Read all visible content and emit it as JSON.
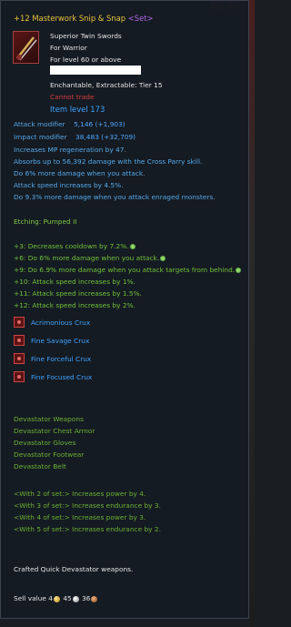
{
  "header": {
    "title": "+12 Masterwork Snip & Snap",
    "set_tag": "<Set>"
  },
  "item": {
    "type": "Superior Twin Swords",
    "class": "For Warrior",
    "level_req": "For level 60 or above",
    "enchant": "Enchantable, Extractable: Tier 15",
    "trade": "Cannot trade",
    "item_level": "Item level 173"
  },
  "stats": {
    "attack_label": "Attack modifier",
    "attack_value": "5,146 (+1,903)",
    "impact_label": "Impact modifier",
    "impact_value": "38,483 (+32,709)"
  },
  "bonuses": [
    "Increases MP regeneration by 47.",
    "Absorbs up to 56,392 damage with the Cross Parry skill.",
    "Do 6% more damage when you attack.",
    "Attack speed increases by 4.5%.",
    "Do 9.3% more damage when you attack enraged monsters."
  ],
  "etching": "Etching: Pumped II",
  "enchant_bonuses": [
    "+3: Decreases cooldown by 7.2%.",
    "+6: Do 6% more damage when you attack.",
    "+9: Do 6.9% more damage when you attack targets from behind.",
    "+10: Attack speed increases by 1%.",
    "+11: Attack speed increases by 1.5%.",
    "+12: Attack speed increases by 2%."
  ],
  "crux": [
    "Acrimonious Crux",
    "Fine Savage Crux",
    "Fine Forceful Crux",
    "Fine Focused Crux"
  ],
  "set_items": [
    "Devastator Weapons",
    "Devastator Chest Armor",
    "Devastator Gloves",
    "Devastator Footwear",
    "Devastator Belt"
  ],
  "set_bonuses": [
    "<With 2 of set:> Increases power by 4.",
    "<With 3 of set:> Increases endurance by 3.",
    "<With 4 of set:> Increases power by 3.",
    "<With 5 of set:> Increases endurance by 2."
  ],
  "crafted": "Crafted Quick Devastator weapons.",
  "sell": {
    "label": "Sell value",
    "gold": "4",
    "silver": "45",
    "copper": "36"
  }
}
